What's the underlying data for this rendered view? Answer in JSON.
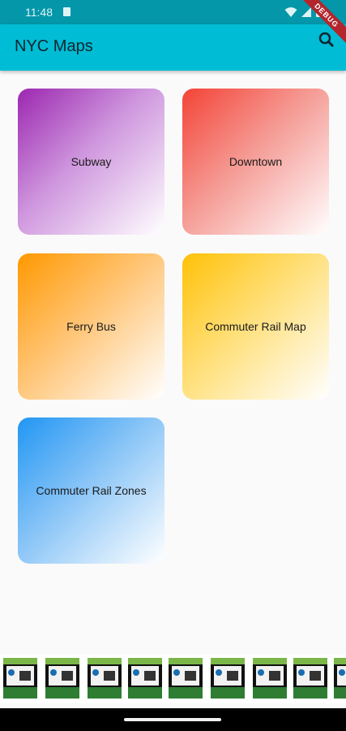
{
  "status_bar": {
    "time": "11:48"
  },
  "app_bar": {
    "title": "NYC Maps"
  },
  "debug_banner": "DEBUG",
  "tiles": [
    {
      "label": "Subway",
      "color": "#9c27b0"
    },
    {
      "label": "Downtown",
      "color": "#f44336"
    },
    {
      "label": "Ferry Bus",
      "color": "#ff9800"
    },
    {
      "label": "Commuter Rail Map",
      "color": "#ffc107"
    },
    {
      "label": "Commuter Rail Zones",
      "color": "#2196f3"
    }
  ],
  "icons": [
    "sd-card-icon",
    "wifi-icon",
    "signal-icon",
    "battery-icon",
    "search-icon"
  ],
  "ad_banner": {
    "item_count": 9
  }
}
